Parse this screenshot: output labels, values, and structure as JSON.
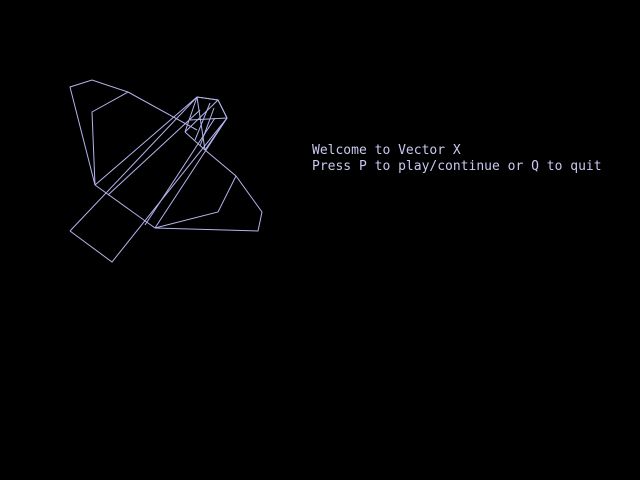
{
  "title_screen": {
    "welcome_text": "Welcome to Vector X",
    "prompt_text": "Press P to play/continue or Q to quit"
  },
  "colors": {
    "background": "#000000",
    "wireframe": "#b4b4ee",
    "text": "#c8c8f0"
  },
  "graphic": {
    "name": "wireframe-spaceship"
  }
}
